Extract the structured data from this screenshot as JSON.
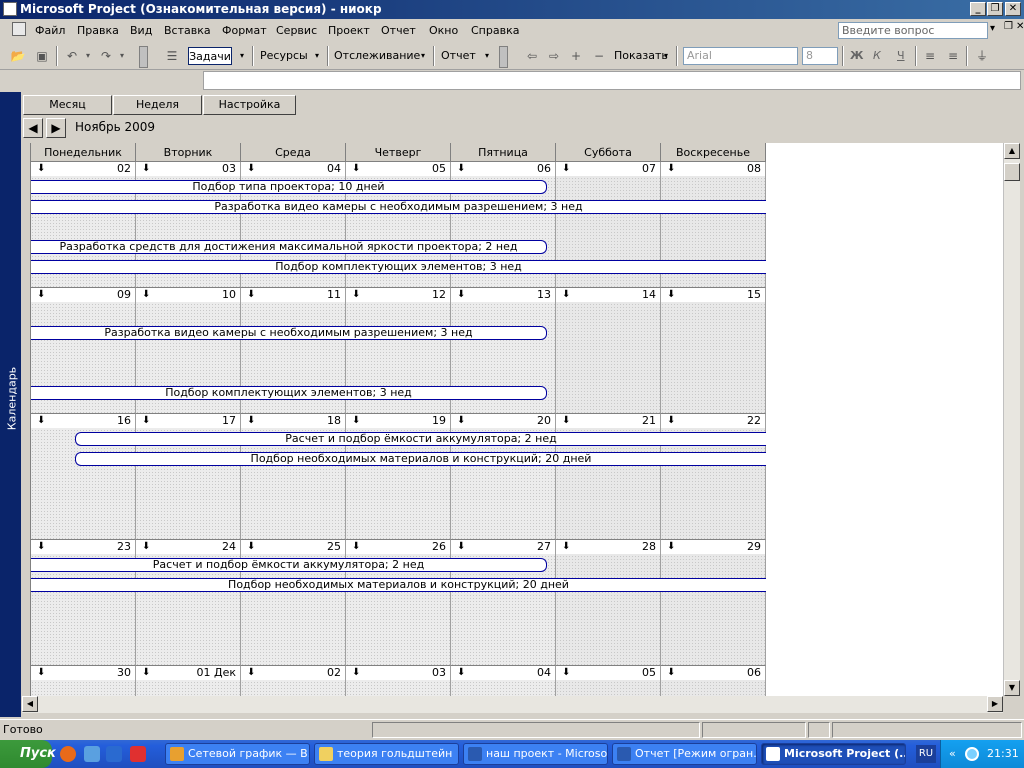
{
  "window": {
    "title": "Microsoft Project (Ознакомительная версия) - ниокр"
  },
  "menu": {
    "items": [
      "Файл",
      "Правка",
      "Вид",
      "Вставка",
      "Формат",
      "Сервис",
      "Проект",
      "Отчет",
      "Окно",
      "Справка"
    ],
    "ask_placeholder": "Введите вопрос"
  },
  "toolbar": {
    "tasks": "Задачи",
    "resources": "Ресурсы",
    "tracking": "Отслеживание",
    "report": "Отчет",
    "show": "Показать",
    "font": "Arial",
    "font_size": "8",
    "bold": "Ж",
    "italic": "К",
    "underline": "Ч"
  },
  "sidebar": {
    "label": "Календарь"
  },
  "tabs": [
    "Месяц",
    "Неделя",
    "Настройка"
  ],
  "month": {
    "label": "Ноябрь 2009"
  },
  "days": [
    "Понедельник",
    "Вторник",
    "Среда",
    "Четверг",
    "Пятница",
    "Суббота",
    "Воскресенье"
  ],
  "weeks": [
    {
      "dates": [
        "02",
        "03",
        "04",
        "05",
        "06",
        "07",
        "08"
      ],
      "bars": [
        {
          "text": "Подбор типа проектора; 10 дней"
        },
        {
          "text": "Разработка видео камеры с необходимым разрешением; 3 нед"
        },
        {
          "text": "Разработка средств для достижения максимальной яркости проектора; 2 нед"
        },
        {
          "text": "Подбор комплектующих элементов; 3 нед"
        }
      ]
    },
    {
      "dates": [
        "09",
        "10",
        "11",
        "12",
        "13",
        "14",
        "15"
      ],
      "bars": [
        {
          "text": "Разработка видео камеры с необходимым разрешением; 3 нед"
        },
        {
          "text": "Подбор комплектующих элементов; 3 нед"
        }
      ]
    },
    {
      "dates": [
        "16",
        "17",
        "18",
        "19",
        "20",
        "21",
        "22"
      ],
      "bars": [
        {
          "text": "Расчет и подбор ёмкости аккумулятора; 2 нед"
        },
        {
          "text": "Подбор необходимых материалов и конструкций; 20 дней"
        }
      ]
    },
    {
      "dates": [
        "23",
        "24",
        "25",
        "26",
        "27",
        "28",
        "29"
      ],
      "bars": [
        {
          "text": "Расчет и подбор ёмкости аккумулятора; 2 нед"
        },
        {
          "text": "Подбор необходимых материалов и конструкций; 20 дней"
        }
      ]
    },
    {
      "dates": [
        "30",
        "01 Дек",
        "02",
        "03",
        "04",
        "05",
        "06"
      ],
      "bars": []
    }
  ],
  "status": {
    "text": "Готово"
  },
  "taskbar": {
    "start": "Пуск",
    "tasks": [
      "Сетевой график — В...",
      "теория гольдштейн",
      "наш проект - Microso...",
      "Отчет [Режим огран...",
      "Microsoft Project (..."
    ],
    "lang": "RU",
    "clock": "21:31"
  }
}
